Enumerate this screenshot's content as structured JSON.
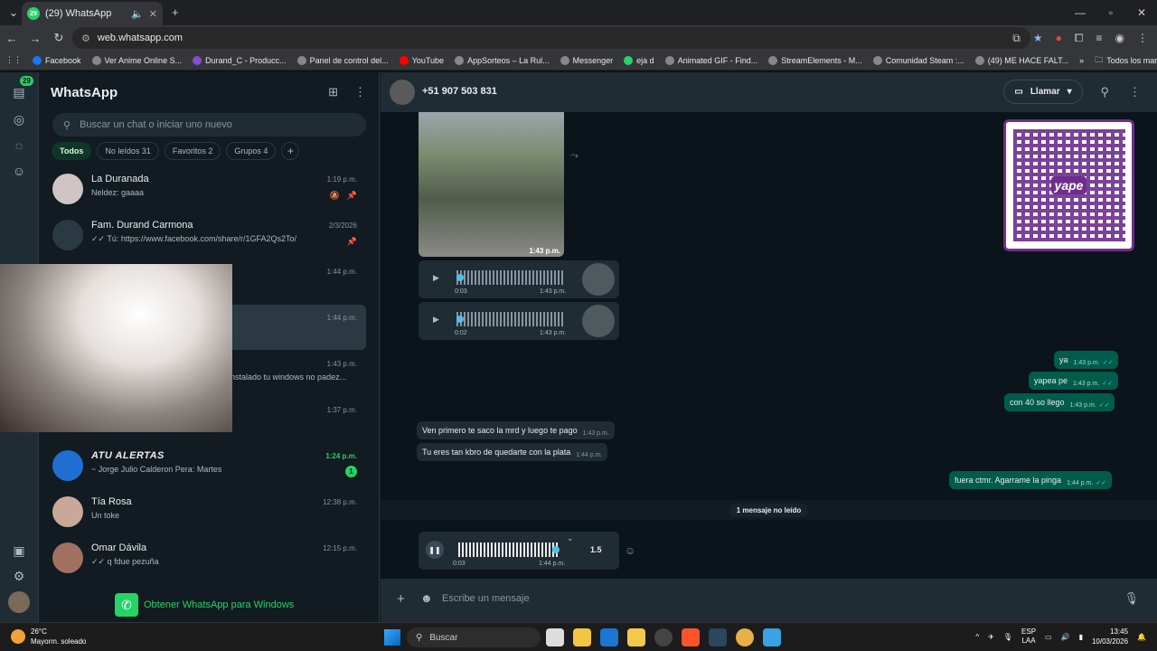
{
  "browser": {
    "tab_title": "(29) WhatsApp",
    "tab_badge": "29",
    "url": "web.whatsapp.com",
    "bookmarks": [
      "Facebook",
      "Ver Anime Online S...",
      "Durand_C - Producc...",
      "Panel de control del...",
      "YouTube",
      "AppSorteos – La Rul...",
      "Messenger",
      "eja d",
      "Animated GIF - Find...",
      "StreamElements - M...",
      "Comunidad Steam :...",
      "(49) ME HACE FALT...",
      "Todos los marcadores"
    ]
  },
  "rail": {
    "chats_badge": "29"
  },
  "sidebar": {
    "title": "WhatsApp",
    "search_placeholder": "Buscar un chat o iniciar uno nuevo",
    "filters": [
      {
        "label": "Todos",
        "active": true
      },
      {
        "label": "No leídos 31"
      },
      {
        "label": "Favoritos 2"
      },
      {
        "label": "Grupos 4"
      }
    ],
    "chats": [
      {
        "name": "La Duranada",
        "preview": "Neldez: gaaaa",
        "time": "1:19 p.m."
      },
      {
        "name": "Fam. Durand Carmona",
        "preview": "✓✓ Tú: https://www.facebook.com/share/r/1GFA2Qs2To/",
        "time": "2/3/2026"
      },
      {
        "name": "",
        "preview": "",
        "time": "1:44 p.m."
      },
      {
        "name": "",
        "preview": "",
        "time": "1:44 p.m."
      },
      {
        "name": "",
        "preview": "nstalado tu windows no padez...",
        "time": "1:43 p.m."
      },
      {
        "name": "",
        "preview": "",
        "time": "1:37 p.m."
      },
      {
        "name": "ATU ALERTAS",
        "preview": "~ Jorge Julio Calderon Pera: Martes",
        "time": "1:24 p.m.",
        "unread": "1"
      },
      {
        "name": "Tía Rosa",
        "preview": "Un toke",
        "time": "12:38 p.m."
      },
      {
        "name": "Omar Dávila",
        "preview": "✓✓ q fdue pezuña",
        "time": "12:15 p.m."
      }
    ],
    "get_app": "Obtener WhatsApp para Windows"
  },
  "conversation": {
    "contact": "+51 907 503 831",
    "call_label": "Llamar",
    "image_time": "1:43 p.m.",
    "voice_notes": [
      {
        "duration": "0:03",
        "time": "1:43 p.m."
      },
      {
        "duration": "0:02",
        "time": "1:43 p.m."
      }
    ],
    "outgoing": [
      {
        "text": "ya",
        "time": "1:43 p.m."
      },
      {
        "text": "yapea pe",
        "time": "1:43 p.m."
      },
      {
        "text": "con 40 so llego",
        "time": "1:43 p.m."
      },
      {
        "text": "fuera ctmr. Agarrame la pinga",
        "time": "1:44 p.m."
      }
    ],
    "incoming": [
      {
        "text": "Ven primero te saco la mrd y luego te pago",
        "time": "1:43 p.m."
      },
      {
        "text": "Tu eres tan kbro de quedarte con la plata",
        "time": "1:44 p.m."
      }
    ],
    "qr_logo": "yape",
    "unread_divider": "1 mensaje no leído",
    "playing": {
      "duration": "0:03",
      "time": "1:44 p.m.",
      "speed": "1.5"
    },
    "composer_placeholder": "Escribe un mensaje"
  },
  "taskbar": {
    "temp": "26°C",
    "weather": "Mayorm. soleado",
    "search": "Buscar",
    "lang1": "ESP",
    "lang2": "LAA",
    "time": "13:45",
    "date": "10/03/2026"
  },
  "colors": {
    "accent": "#25d366",
    "bubble_out": "#005c4b",
    "bubble_in": "#202c33",
    "yape": "#6e2d8d"
  }
}
